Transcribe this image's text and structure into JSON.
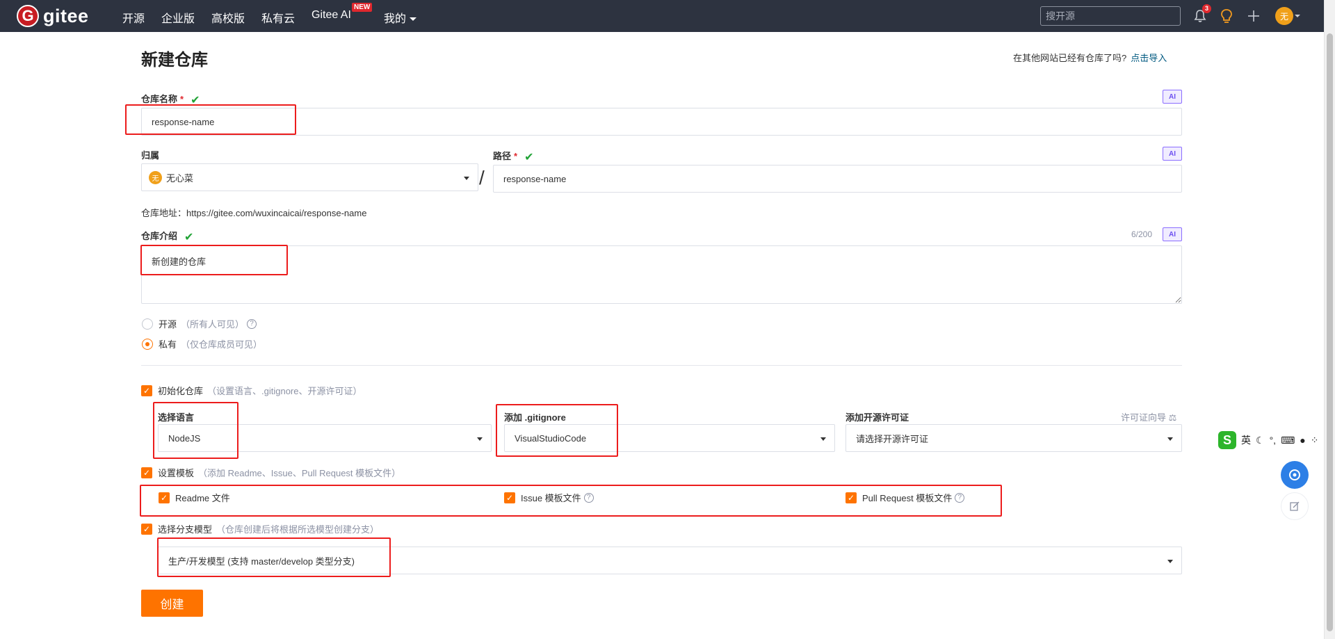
{
  "topnav": {
    "logo_glyph": "G",
    "logo_text": "gitee",
    "links": [
      "开源",
      "企业版",
      "高校版",
      "私有云",
      "Gitee AI",
      "我的"
    ],
    "new_badge": "NEW",
    "search_placeholder": "搜开源",
    "notification_count": "3",
    "avatar_text": "无"
  },
  "page": {
    "title": "新建仓库",
    "import_prompt": "在其他网站已经有仓库了吗?",
    "import_link": "点击导入"
  },
  "form": {
    "ai_badge": "AI",
    "repo_name_label": "仓库名称",
    "required_mark": "*",
    "repo_name_value": "response-name",
    "owner_label": "归属",
    "owner_avatar": "无",
    "owner_value": "无心菜",
    "path_label": "路径",
    "path_value": "response-name",
    "separator": "/",
    "repo_address_label": "仓库地址：",
    "repo_address_value": "https://gitee.com/wuxincaicai/response-name",
    "description_label": "仓库介绍",
    "description_value": "新创建的仓库",
    "description_counter": "6/200",
    "visibility": {
      "public_label": "开源",
      "public_hint": "（所有人可见）",
      "private_label": "私有",
      "private_hint": "（仅仓库成员可见）",
      "selected": "private"
    },
    "init_repo": {
      "label": "初始化仓库",
      "hint": "（设置语言、.gitignore、开源许可证）",
      "checked": true,
      "language_label": "选择语言",
      "language_value": "NodeJS",
      "gitignore_label": "添加 .gitignore",
      "gitignore_value": "VisualStudioCode",
      "license_label": "添加开源许可证",
      "license_guide": "许可证向导",
      "license_placeholder": "请选择开源许可证"
    },
    "templates": {
      "label": "设置模板",
      "hint": "（添加 Readme、Issue、Pull Request 模板文件）",
      "checked": true,
      "readme_label": "Readme 文件",
      "issue_label": "Issue 模板文件",
      "pr_label": "Pull Request 模板文件"
    },
    "branch_model": {
      "label": "选择分支模型",
      "hint": "（仓库创建后将根据所选模型创建分支）",
      "checked": true,
      "value": "生产/开发模型 (支持 master/develop 类型分支)"
    },
    "create_button": "创建"
  },
  "ime": {
    "logo": "S",
    "mode": "英",
    "icons": [
      "moon-icon",
      "punctuation-icon",
      "keyboard-icon",
      "user-icon",
      "grid-icon"
    ]
  },
  "colors": {
    "nav_bg": "#2d3340",
    "accent": "#fe7300",
    "link": "#005980",
    "annotation_red": "#ec1c1c",
    "success": "#21a336"
  }
}
